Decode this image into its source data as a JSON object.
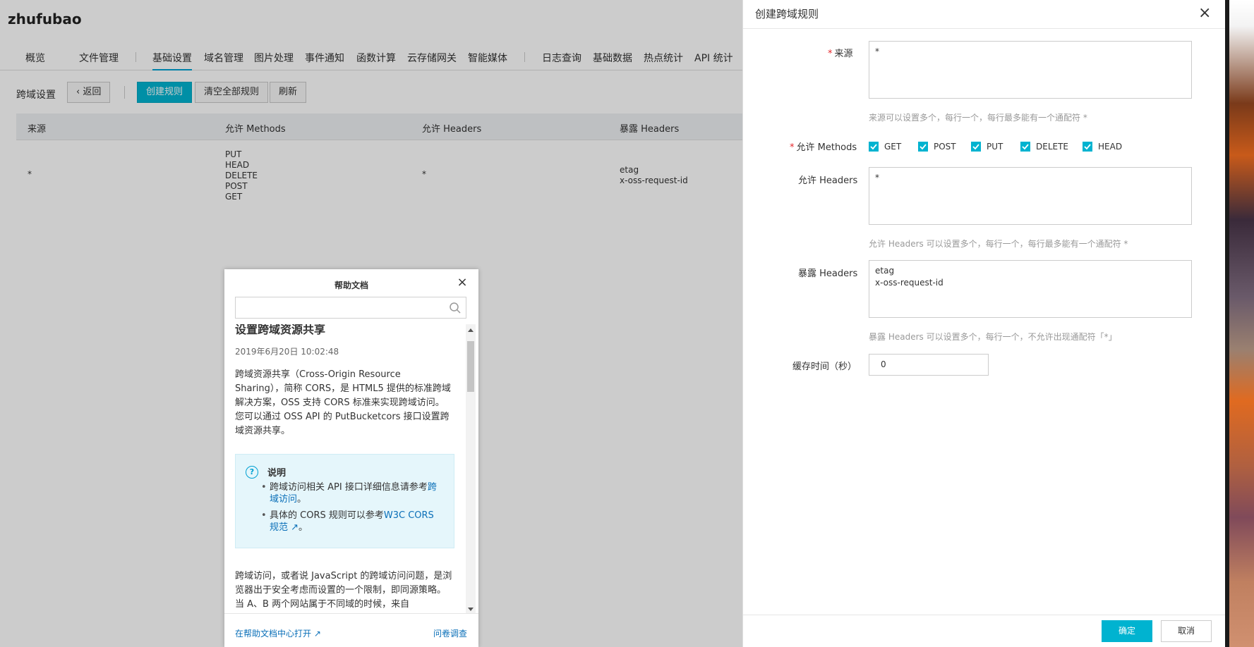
{
  "app": {
    "brand": "zhufubao"
  },
  "nav": {
    "tabs": [
      {
        "label": "概览"
      },
      {
        "label": "文件管理"
      },
      {
        "label": "基础设置"
      },
      {
        "label": "域名管理"
      },
      {
        "label": "图片处理"
      },
      {
        "label": "事件通知"
      },
      {
        "label": "函数计算"
      },
      {
        "label": "云存储网关"
      },
      {
        "label": "智能媒体"
      },
      {
        "label": "日志查询"
      },
      {
        "label": "基础数据"
      },
      {
        "label": "热点统计"
      },
      {
        "label": "API 统计"
      }
    ],
    "active": "基础设置"
  },
  "toolbar": {
    "section_label": "跨域设置",
    "back_label": "返回",
    "create_label": "创建规则",
    "clear_label": "清空全部规则",
    "refresh_label": "刷新"
  },
  "table": {
    "columns": [
      "来源",
      "允许 Methods",
      "允许 Headers",
      "暴露 Headers"
    ],
    "rows": [
      {
        "origin": "*",
        "methods": [
          "PUT",
          "HEAD",
          "DELETE",
          "POST",
          "GET"
        ],
        "allow_headers": "*",
        "expose_headers": [
          "etag",
          "x-oss-request-id"
        ]
      }
    ]
  },
  "help": {
    "title": "帮助文档",
    "search_placeholder": "",
    "doc_title": "设置跨域资源共享",
    "doc_date": "2019年6月20日 10:02:48",
    "para1": "跨域资源共享（Cross-Origin Resource Sharing），简称 CORS，是 HTML5 提供的标准跨域解决方案，OSS 支持 CORS 标准来实现跨域访问。您可以通过 OSS API 的 PutBucketcors 接口设置跨域资源共享。",
    "note_label": "说明",
    "note_item1_prefix": "跨域访问相关 API 接口详细信息请参考",
    "note_item1_link": "跨域访问",
    "note_item1_suffix": "。",
    "note_item2_prefix": "具体的 CORS 规则可以参考",
    "note_item2_link": "W3C CORS 规范",
    "note_item2_suffix": "。",
    "para2": "跨域访问，或者说 JavaScript 的跨域访问问题，是浏览器出于安全考虑而设置的一个限制，即同源策略。当 A、B 两个网站属于不同域的时候，来自",
    "open_in_center": "在帮助文档中心打开",
    "survey": "问卷调查"
  },
  "drawer": {
    "title": "创建跨域规则",
    "origin_label": "来源",
    "origin_value": "*",
    "origin_hint": "来源可以设置多个，每行一个，每行最多能有一个通配符 *",
    "methods_label": "允许 Methods",
    "methods": [
      {
        "label": "GET",
        "checked": true
      },
      {
        "label": "POST",
        "checked": true
      },
      {
        "label": "PUT",
        "checked": true
      },
      {
        "label": "DELETE",
        "checked": true
      },
      {
        "label": "HEAD",
        "checked": true
      }
    ],
    "allow_headers_label": "允许 Headers",
    "allow_headers_value": "*",
    "allow_headers_hint": "允许 Headers 可以设置多个，每行一个，每行最多能有一个通配符 *",
    "expose_headers_label": "暴露 Headers",
    "expose_headers_value": "etag\nx-oss-request-id",
    "expose_headers_hint": "暴露 Headers 可以设置多个，每行一个，不允许出现通配符「*」",
    "cache_label": "缓存时间（秒）",
    "cache_value": "0",
    "ok_label": "确定",
    "cancel_label": "取消"
  },
  "colors": {
    "accent": "#00b3d0",
    "link": "#0a6fb8",
    "required": "#e5262b"
  }
}
